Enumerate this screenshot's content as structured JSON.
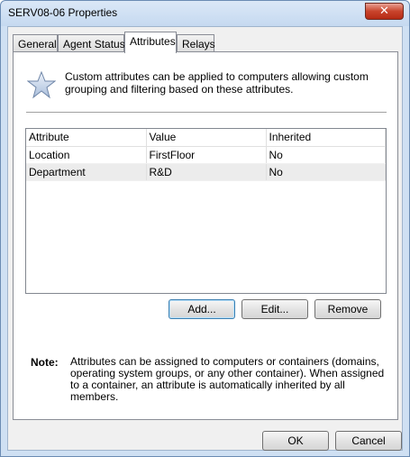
{
  "window": {
    "title": "SERV08-06 Properties",
    "close_glyph": "✕"
  },
  "tabs": [
    {
      "label": "General"
    },
    {
      "label": "Agent Status"
    },
    {
      "label": "Attributes"
    },
    {
      "label": "Relays"
    }
  ],
  "active_tab": "Attributes",
  "intro": {
    "text": "Custom attributes can be applied to computers allowing custom grouping and filtering based on these attributes.",
    "icon": "star-icon"
  },
  "table": {
    "columns": [
      "Attribute",
      "Value",
      "Inherited"
    ],
    "rows": [
      [
        "Location",
        "FirstFloor",
        "No"
      ],
      [
        "Department",
        "R&D",
        "No"
      ]
    ]
  },
  "actions": {
    "add": "Add...",
    "edit": "Edit...",
    "remove": "Remove"
  },
  "note": {
    "label": "Note:",
    "text": "Attributes can be assigned to computers or containers (domains, operating system groups, or any other container). When assigned to a container, an attribute is automatically inherited by all members."
  },
  "footer": {
    "ok": "OK",
    "cancel": "Cancel"
  },
  "colors": {
    "title_bar": "#cfe0f3",
    "close_button": "#c9442c"
  }
}
